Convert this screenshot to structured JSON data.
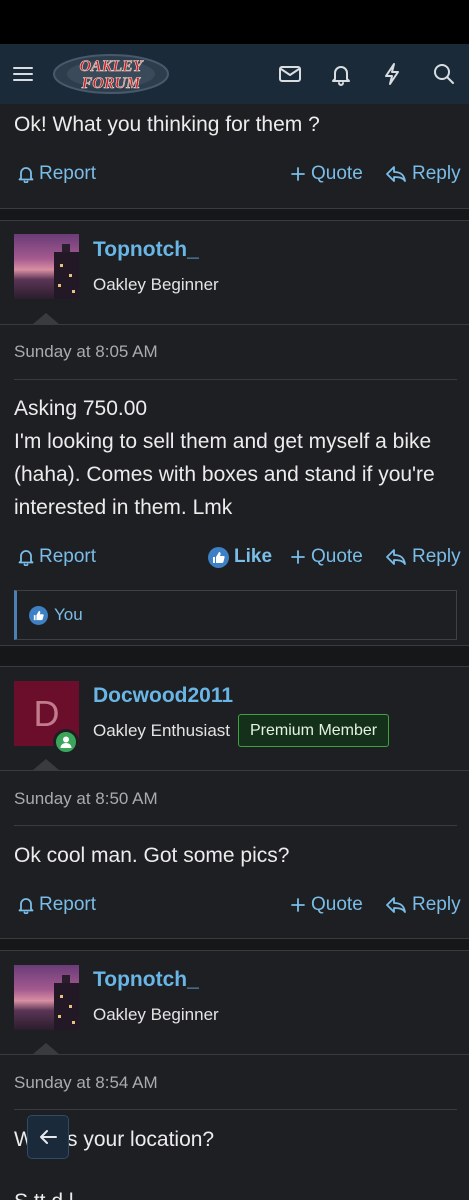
{
  "logo": {
    "line1": "OAKLEY",
    "line2": "FORUM"
  },
  "top_post": {
    "body": "Ok! What you thinking for them ?",
    "report": "Report",
    "quote": "Quote",
    "reply": "Reply"
  },
  "posts": [
    {
      "username": "Topnotch_",
      "title": "Oakley Beginner",
      "date": "Sunday at 8:05 AM",
      "body_lines": [
        "Asking 750.00",
        "I'm looking to sell them and get myself a bike",
        "(haha). Comes with boxes and stand if you're",
        "interested in them. Lmk"
      ],
      "report": "Report",
      "like": "Like",
      "quote": "Quote",
      "reply": "Reply",
      "liked_by": "You"
    },
    {
      "username": "Docwood2011",
      "avatar_letter": "D",
      "title": "Oakley Enthusiast",
      "badge": "Premium Member",
      "date": "Sunday at 8:50 AM",
      "body": "Ok cool man. Got some pics?",
      "report": "Report",
      "quote": "Quote",
      "reply": "Reply"
    },
    {
      "username": "Topnotch_",
      "title": "Oakley Beginner",
      "date": "Sunday at 8:54 AM",
      "body": "What's your location?",
      "body_cut": "S      tt  d    l"
    }
  ],
  "colors": {
    "accent": "#79bde8",
    "username": "#69b6e6",
    "navbar": "#1a2a38",
    "badge_border": "#3ea23e"
  },
  "icons": [
    "menu-icon",
    "inbox-icon",
    "bell-icon",
    "lightning-icon",
    "search-icon",
    "report-bell-icon",
    "plus-icon",
    "reply-icon",
    "thumbs-up-icon",
    "back-arrow-icon",
    "online-user-icon"
  ]
}
